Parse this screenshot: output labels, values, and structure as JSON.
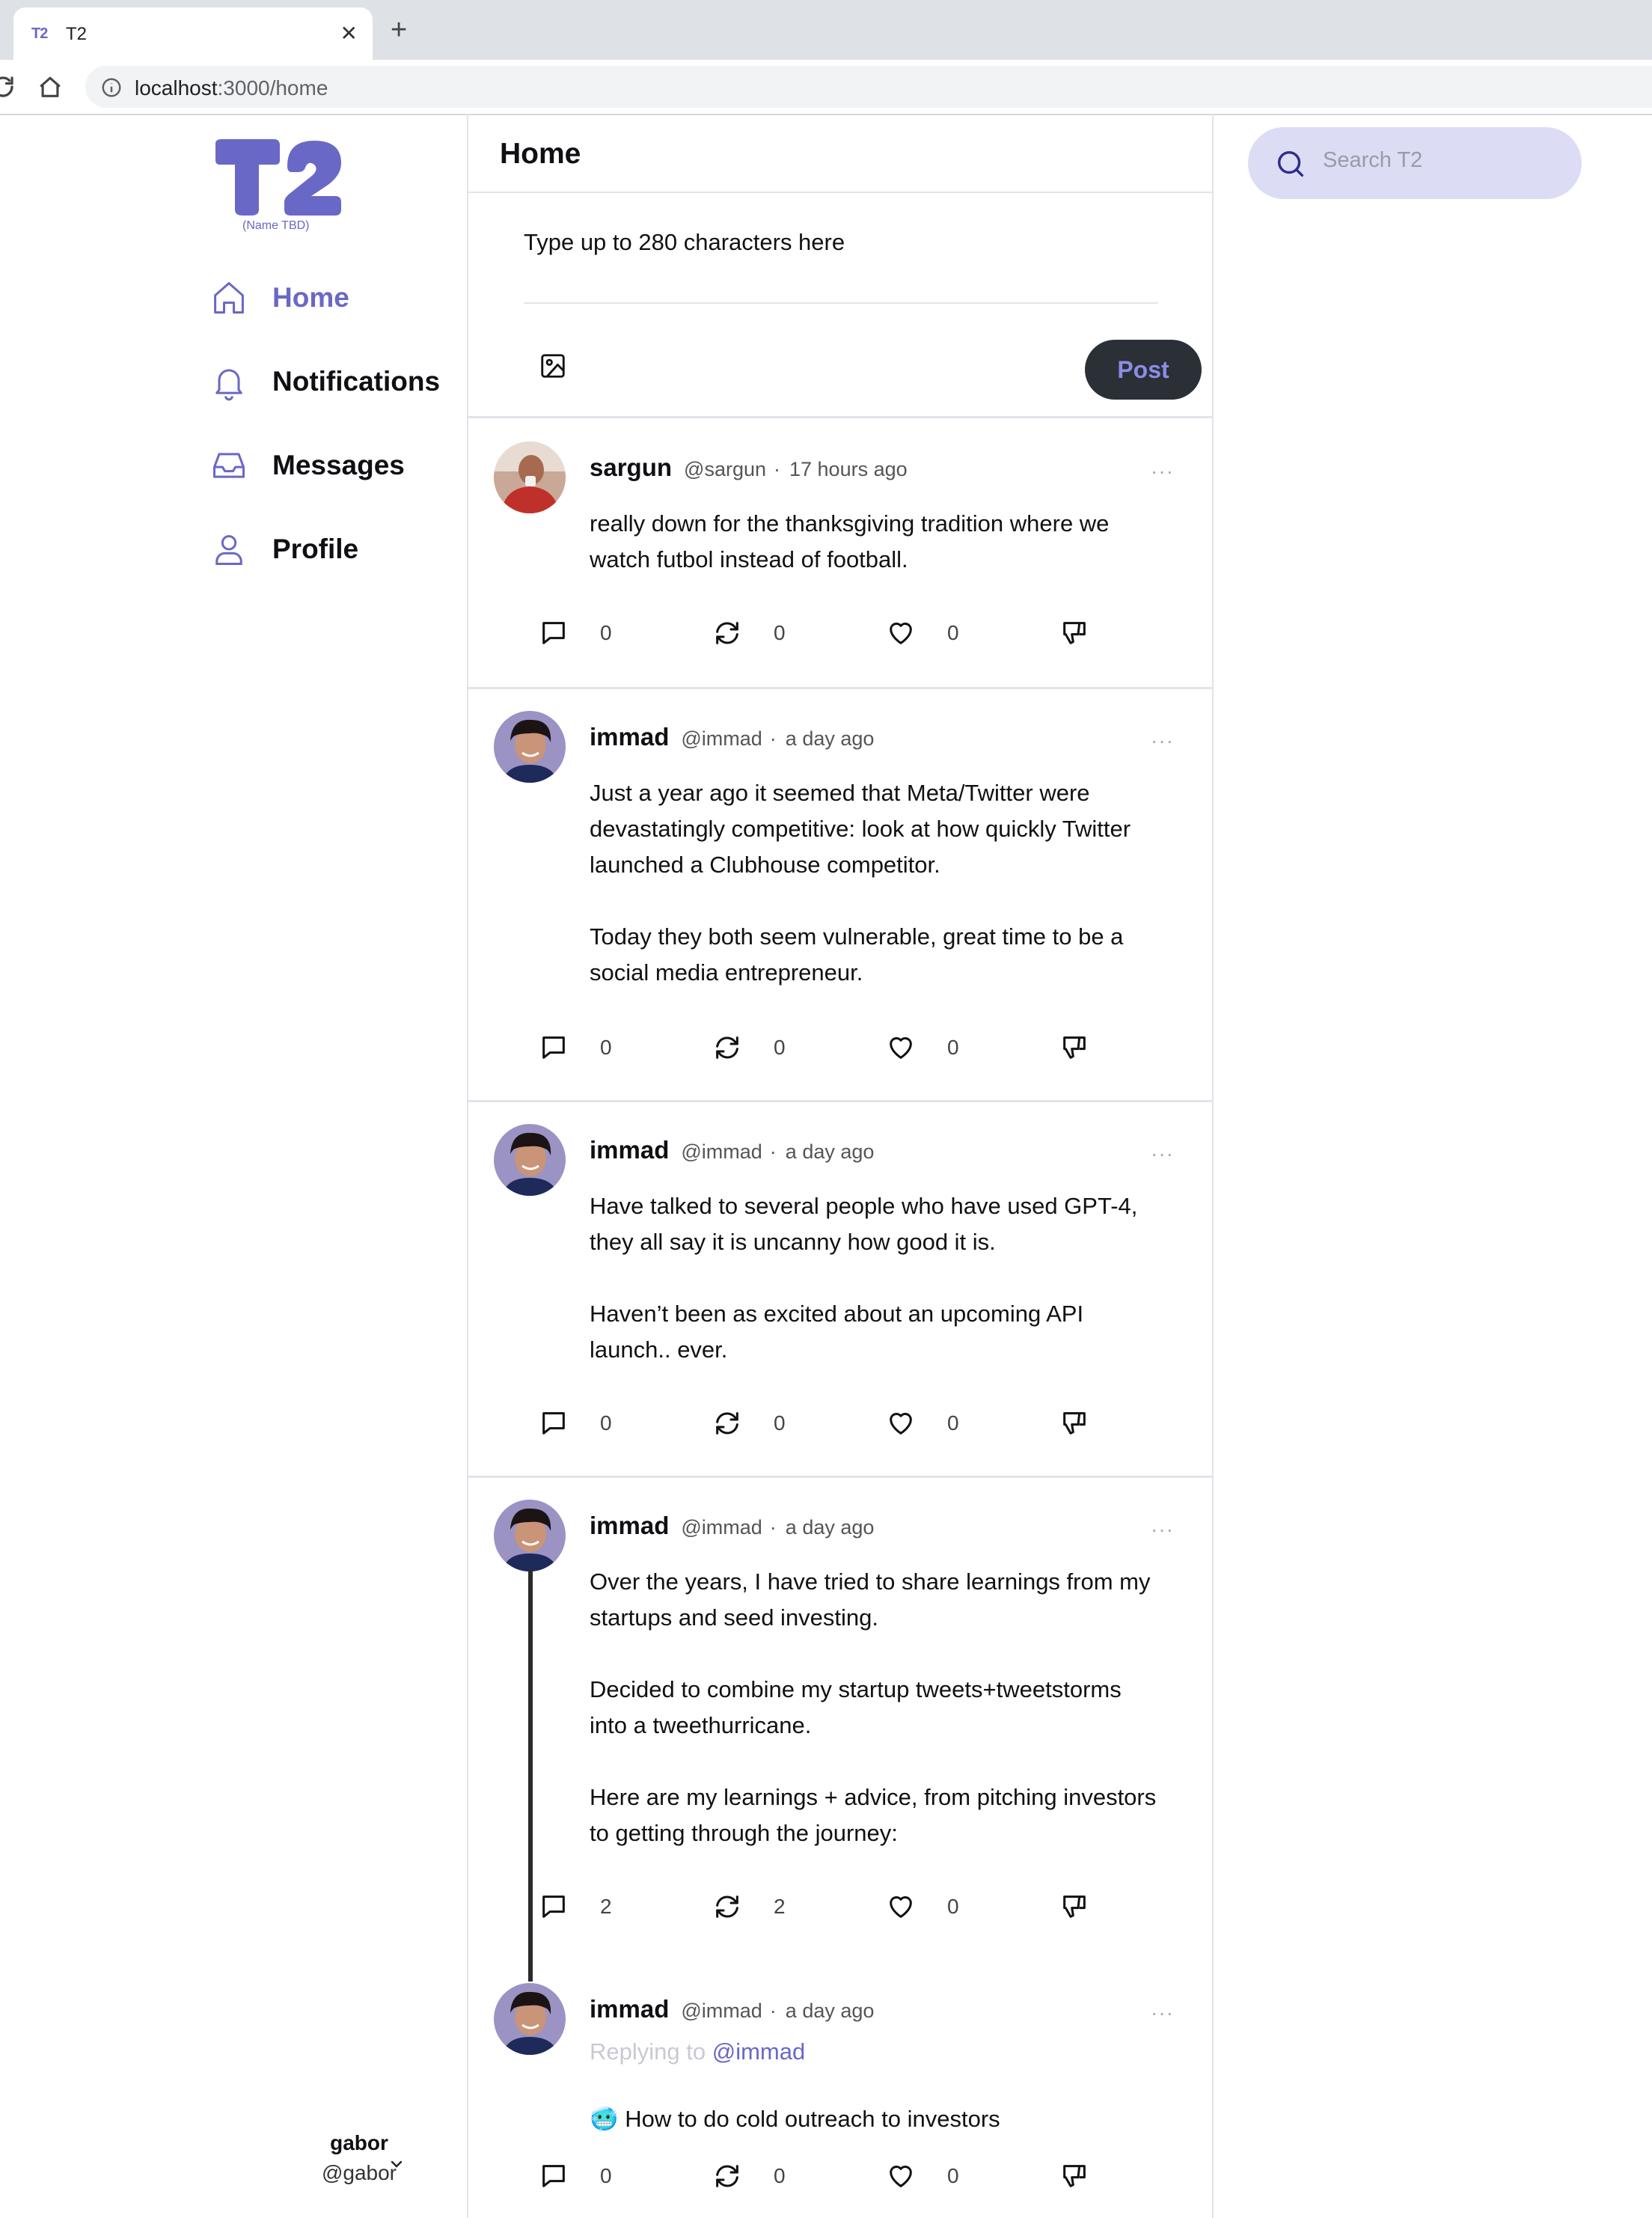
{
  "browser": {
    "tab_title": "T2",
    "tab_favicon": "T2",
    "tab_close": "✕",
    "new_tab": "+",
    "url_host": "localhost",
    "url_path": ":3000/home"
  },
  "sidebar": {
    "logo_text": "T2",
    "logo_subtitle": "(Name TBD)",
    "nav": [
      {
        "label": "Home",
        "icon": "home-icon",
        "active": true
      },
      {
        "label": "Notifications",
        "icon": "bell-icon"
      },
      {
        "label": "Messages",
        "icon": "inbox-icon"
      },
      {
        "label": "Profile",
        "icon": "user-icon"
      }
    ],
    "account": {
      "name": "gabor",
      "handle": "@gabor"
    }
  },
  "main": {
    "title": "Home",
    "composer": {
      "placeholder": "Type up to 280 characters here",
      "post_label": "Post"
    }
  },
  "posts": [
    {
      "name": "sargun",
      "handle": "@sargun",
      "dot": "·",
      "time": "17 hours ago",
      "more": "···",
      "body": "really down for the thanksgiving tradition where we\nwatch futbol instead of football.",
      "replies": "0",
      "reposts": "0",
      "likes": "0"
    },
    {
      "name": "immad",
      "handle": "@immad",
      "dot": "·",
      "time": "a day ago",
      "more": "···",
      "body": "Just a year ago it seemed that Meta/Twitter were\ndevastatingly competitive: look at how quickly Twitter\nlaunched a Clubhouse competitor.\n\nToday they both seem vulnerable, great time to be a\nsocial media entrepreneur.",
      "replies": "0",
      "reposts": "0",
      "likes": "0"
    },
    {
      "name": "immad",
      "handle": "@immad",
      "dot": "·",
      "time": "a day ago",
      "more": "···",
      "body": "Have talked to several people who have used GPT-4,\nthey all say it is uncanny how good it is.\n\nHaven’t been as excited about an upcoming API\nlaunch.. ever.",
      "replies": "0",
      "reposts": "0",
      "likes": "0"
    },
    {
      "name": "immad",
      "handle": "@immad",
      "dot": "·",
      "time": "a day ago",
      "more": "···",
      "body": "Over the years, I have tried to share learnings from my\nstartups and seed investing.\n\nDecided to combine my startup tweets+tweetstorms\ninto a tweethurricane.\n\nHere are my learnings + advice, from pitching investors\nto getting through the journey:",
      "replies": "2",
      "reposts": "2",
      "likes": "0"
    },
    {
      "name": "immad",
      "handle": "@immad",
      "dot": "·",
      "time": "a day ago",
      "more": "···",
      "replying_prefix": "Replying to",
      "replying_to": "@immad",
      "body": "🥶 How to do cold outreach to investors",
      "replies": "0",
      "reposts": "0",
      "likes": "0"
    }
  ],
  "search": {
    "placeholder": "Search T2"
  },
  "colors": {
    "brand": "#6a68c6",
    "post_button_bg": "#2b2f36",
    "search_bg": "#dcdcf4"
  }
}
